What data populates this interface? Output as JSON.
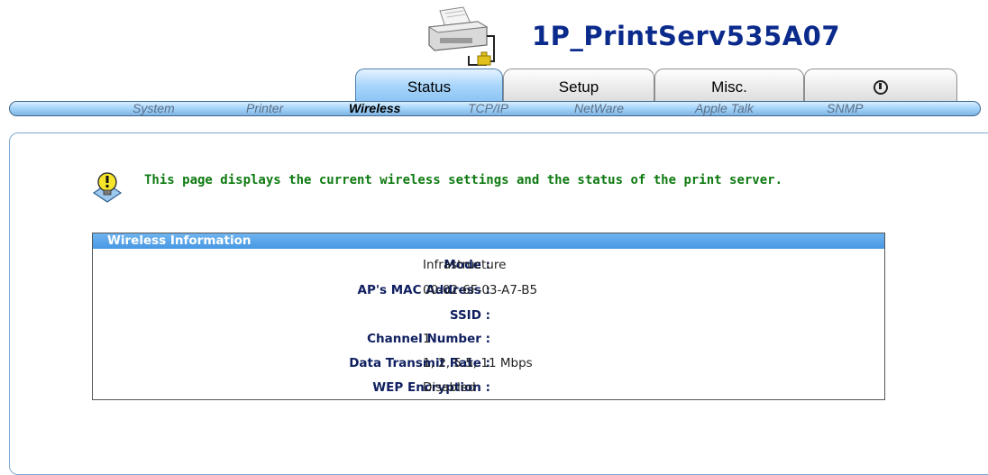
{
  "header": {
    "device_name": "1P_PrintServ535A07",
    "logo_icon": "printer-server-icon"
  },
  "tabs": [
    {
      "label": "Status",
      "active": true
    },
    {
      "label": "Setup",
      "active": false
    },
    {
      "label": "Misc.",
      "active": false
    },
    {
      "icon": "power-icon",
      "active": false
    }
  ],
  "subnav": [
    {
      "label": "System",
      "active": false
    },
    {
      "label": "Printer",
      "active": false
    },
    {
      "label": "Wireless",
      "active": true
    },
    {
      "label": "TCP/IP",
      "active": false
    },
    {
      "label": "NetWare",
      "active": false
    },
    {
      "label": "Apple Talk",
      "active": false
    },
    {
      "label": "SNMP",
      "active": false
    }
  ],
  "hint": {
    "icon": "lightbulb-hint-icon",
    "text": "This page displays the current wireless settings and the status of the print server."
  },
  "wireless_info": {
    "title": "Wireless Information",
    "rows": [
      {
        "label": "Mode :",
        "value": "Infrastructure"
      },
      {
        "label": "AP's MAC Address :",
        "value": "00-02-6F-03-A7-B5"
      },
      {
        "label": "SSID :",
        "value": ""
      },
      {
        "label": "Channel Number :",
        "value": "1"
      },
      {
        "label": "Data Transmit Rate :",
        "value": "1, 2, 5.5, 11 Mbps"
      },
      {
        "label": "WEP Encryption :",
        "value": "Disabled"
      }
    ]
  },
  "colors": {
    "device_name": "#0a2a8c",
    "hint_text": "#0e7a11",
    "table_header": "#4798e4",
    "active_tab": "#a9d6fc"
  }
}
